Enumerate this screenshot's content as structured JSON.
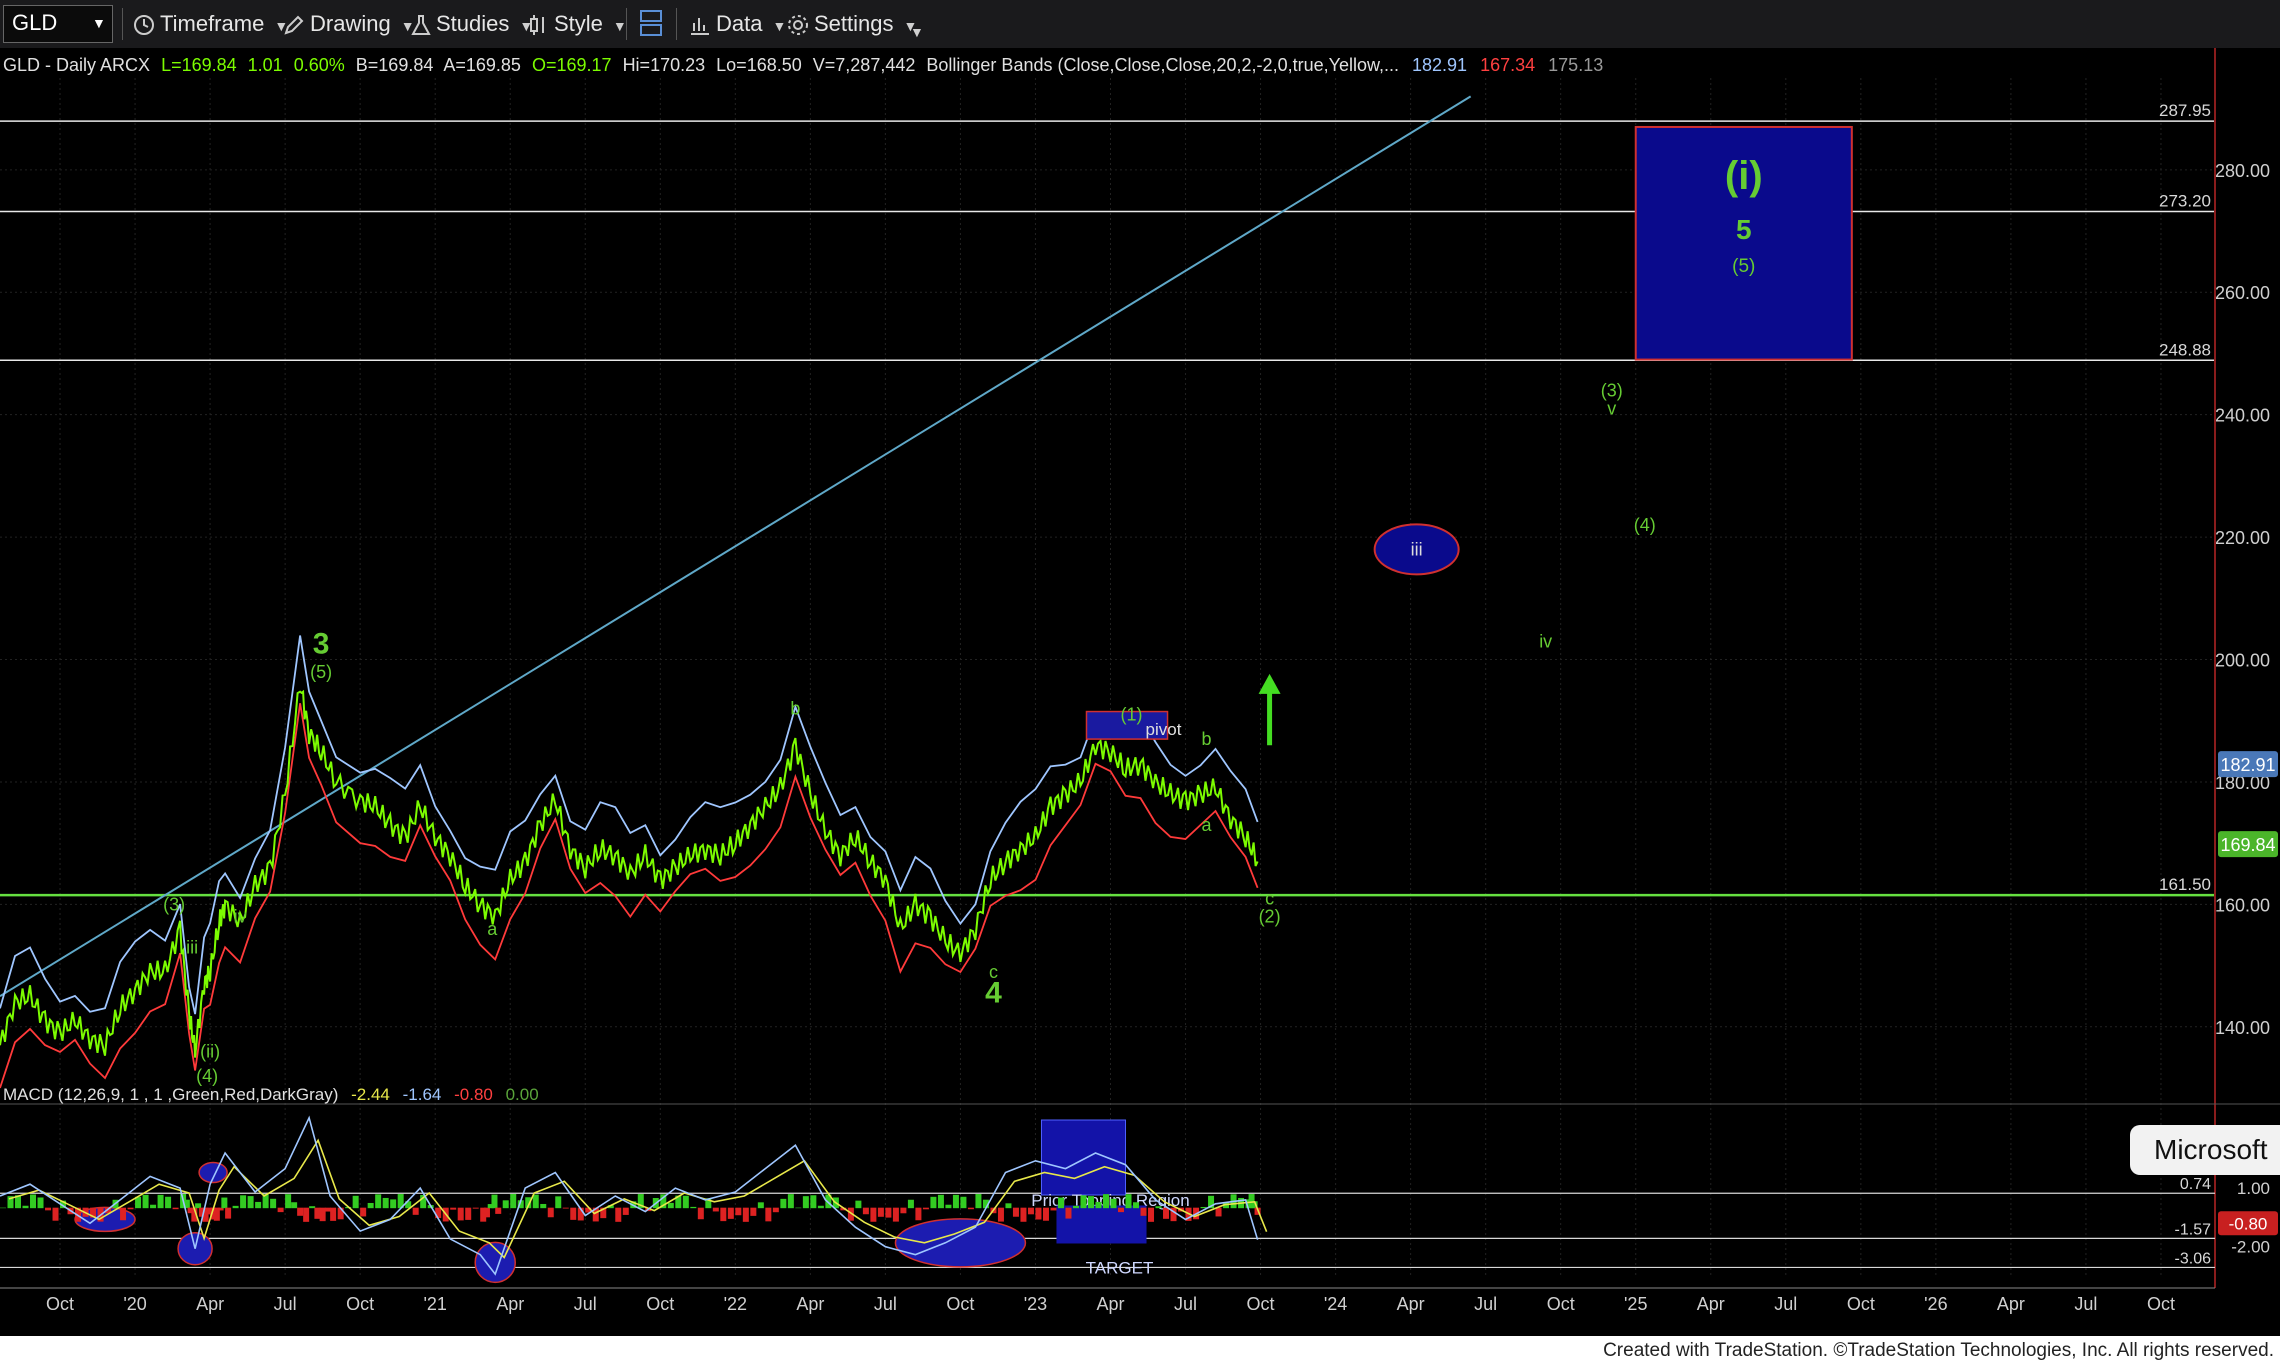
{
  "toolbar": {
    "symbol": "GLD",
    "timeframe": "Timeframe",
    "drawing": "Drawing",
    "studies": "Studies",
    "style": "Style",
    "data": "Data",
    "settings": "Settings"
  },
  "header": {
    "ticker": "GLD - Daily  ARCX",
    "last": "L=169.84",
    "change": "1.01",
    "change_pct": "0.60%",
    "bid": "B=169.84",
    "ask": "A=169.85",
    "open": "O=169.17",
    "high": "Hi=170.23",
    "low": "Lo=168.50",
    "volume": "V=7,287,442",
    "indicator": "Bollinger Bands (Close,Close,Close,20,2,-2,0,true,Yellow,...",
    "bb_upper": "182.91",
    "bb_lower": "167.34",
    "bb_mid": "175.13"
  },
  "macd_header": {
    "name": "MACD (12,26,9, 1 , 1 ,Green,Red,DarkGray)",
    "v1": "-2.44",
    "v2": "-1.64",
    "v3": "-0.80",
    "v4": "0.00"
  },
  "footer": "Created with TradeStation. ©TradeStation Technologies, Inc. All rights reserved.",
  "overlay_button": "Microsoft",
  "colors": {
    "background": "#000000",
    "price": "#7CFC00",
    "upper_band": "#9fc6ff",
    "lower_band": "#ff3a3a",
    "trendline": "#5fa8c8",
    "support": "#66e040",
    "level": "#e8e8e8",
    "label_green": "#66cc33",
    "box_blue": "#0a0a8c",
    "box_edge": "#d03030"
  },
  "chart_data": {
    "type": "line",
    "ylim": [
      130,
      295
    ],
    "y_ticks": [
      {
        "value": 140,
        "label": "140.00"
      },
      {
        "value": 160,
        "label": "160.00"
      },
      {
        "value": 180,
        "label": "180.00"
      },
      {
        "value": 200,
        "label": "200.00"
      },
      {
        "value": 220,
        "label": "220.00"
      },
      {
        "value": 240,
        "label": "240.00"
      },
      {
        "value": 260,
        "label": "260.00"
      },
      {
        "value": 280,
        "label": "280.00"
      }
    ],
    "x_ticks": [
      {
        "t": 2019.75,
        "label": "Oct"
      },
      {
        "t": 2020.0,
        "label": "'20"
      },
      {
        "t": 2020.25,
        "label": "Apr"
      },
      {
        "t": 2020.5,
        "label": "Jul"
      },
      {
        "t": 2020.75,
        "label": "Oct"
      },
      {
        "t": 2021.0,
        "label": "'21"
      },
      {
        "t": 2021.25,
        "label": "Apr"
      },
      {
        "t": 2021.5,
        "label": "Jul"
      },
      {
        "t": 2021.75,
        "label": "Oct"
      },
      {
        "t": 2022.0,
        "label": "'22"
      },
      {
        "t": 2022.25,
        "label": "Apr"
      },
      {
        "t": 2022.5,
        "label": "Jul"
      },
      {
        "t": 2022.75,
        "label": "Oct"
      },
      {
        "t": 2023.0,
        "label": "'23"
      },
      {
        "t": 2023.25,
        "label": "Apr"
      },
      {
        "t": 2023.5,
        "label": "Jul"
      },
      {
        "t": 2023.75,
        "label": "Oct"
      },
      {
        "t": 2024.0,
        "label": "'24"
      },
      {
        "t": 2024.25,
        "label": "Apr"
      },
      {
        "t": 2024.5,
        "label": "Jul"
      },
      {
        "t": 2024.75,
        "label": "Oct"
      },
      {
        "t": 2025.0,
        "label": "'25"
      },
      {
        "t": 2025.25,
        "label": "Apr"
      },
      {
        "t": 2025.5,
        "label": "Jul"
      },
      {
        "t": 2025.75,
        "label": "Oct"
      },
      {
        "t": 2026.0,
        "label": "'26"
      },
      {
        "t": 2026.25,
        "label": "Apr"
      },
      {
        "t": 2026.5,
        "label": "Jul"
      },
      {
        "t": 2026.75,
        "label": "Oct"
      }
    ],
    "price_series": {
      "t": [
        2019.55,
        2019.6,
        2019.65,
        2019.7,
        2019.75,
        2019.8,
        2019.85,
        2019.9,
        2019.95,
        2020.0,
        2020.05,
        2020.1,
        2020.15,
        2020.18,
        2020.2,
        2020.23,
        2020.25,
        2020.28,
        2020.3,
        2020.35,
        2020.4,
        2020.45,
        2020.5,
        2020.55,
        2020.58,
        2020.62,
        2020.67,
        2020.75,
        2020.8,
        2020.85,
        2020.9,
        2020.95,
        2021.0,
        2021.05,
        2021.1,
        2021.15,
        2021.2,
        2021.25,
        2021.3,
        2021.35,
        2021.4,
        2021.45,
        2021.5,
        2021.55,
        2021.6,
        2021.65,
        2021.7,
        2021.75,
        2021.8,
        2021.85,
        2021.9,
        2021.95,
        2022.0,
        2022.05,
        2022.1,
        2022.15,
        2022.2,
        2022.25,
        2022.3,
        2022.35,
        2022.4,
        2022.45,
        2022.5,
        2022.55,
        2022.6,
        2022.65,
        2022.7,
        2022.75,
        2022.8,
        2022.85,
        2022.9,
        2022.95,
        2023.0,
        2023.05,
        2023.1,
        2023.15,
        2023.2,
        2023.25,
        2023.3,
        2023.35,
        2023.4,
        2023.45,
        2023.5,
        2023.55,
        2023.6,
        2023.65,
        2023.7,
        2023.74
      ],
      "close": [
        137,
        144,
        145,
        141,
        139,
        141,
        138,
        137,
        143,
        146,
        149,
        149,
        156,
        142,
        136,
        147,
        149,
        157,
        160,
        157,
        163,
        166,
        178,
        196,
        188,
        185,
        180,
        177,
        176,
        173,
        171,
        176,
        171,
        168,
        163,
        160,
        158,
        164,
        167,
        173,
        177,
        169,
        166,
        169,
        168,
        165,
        168,
        164,
        166,
        168,
        169,
        168,
        170,
        173,
        176,
        179,
        186,
        178,
        172,
        168,
        171,
        167,
        164,
        156,
        160,
        158,
        154,
        152,
        156,
        164,
        167,
        169,
        171,
        176,
        178,
        180,
        186,
        185,
        182,
        183,
        180,
        178,
        177,
        178,
        179,
        174,
        171,
        167
      ]
    },
    "levels": [
      {
        "value": 287.95,
        "label": "287.95"
      },
      {
        "value": 273.2,
        "label": "273.20"
      },
      {
        "value": 248.88,
        "label": "248.88"
      },
      {
        "value": 161.5,
        "label": "161.50"
      }
    ],
    "price_markers": [
      {
        "value": 182.91,
        "label": "182.91"
      },
      {
        "value": 169.84,
        "label": "169.84"
      }
    ],
    "trendline": {
      "t0": 2019.55,
      "v0": 145,
      "t1": 2024.45,
      "v1": 292
    },
    "target_box": {
      "t0": 2025.0,
      "t1": 2025.72,
      "v0": 249,
      "v1": 287,
      "labels": [
        "(i)",
        "5",
        "(5)"
      ]
    },
    "pivot_box": {
      "t0": 2023.17,
      "t1": 2023.44,
      "v0": 187,
      "v1": 191.5,
      "label": "pivot"
    },
    "iii_ellipse": {
      "t": 2024.27,
      "v": 218,
      "label": "iii"
    },
    "wave_labels": [
      {
        "text": "3",
        "t": 2020.62,
        "v": 201,
        "big": true
      },
      {
        "text": "(5)",
        "t": 2020.62,
        "v": 197,
        "big": false
      },
      {
        "text": "iii",
        "t": 2020.19,
        "v": 152,
        "big": false
      },
      {
        "text": "(3)",
        "t": 2020.13,
        "v": 159,
        "big": false
      },
      {
        "text": "iv",
        "t": 2020.35,
        "v": 157,
        "big": false
      },
      {
        "text": "(ii)",
        "t": 2020.25,
        "v": 135,
        "big": false
      },
      {
        "text": "(4)",
        "t": 2020.24,
        "v": 131,
        "big": false
      },
      {
        "text": "a",
        "t": 2021.19,
        "v": 155,
        "big": false
      },
      {
        "text": "b",
        "t": 2022.2,
        "v": 191,
        "big": false
      },
      {
        "text": "c",
        "t": 2022.86,
        "v": 148,
        "big": false
      },
      {
        "text": "4",
        "t": 2022.86,
        "v": 144,
        "big": true
      },
      {
        "text": "(1)",
        "t": 2023.32,
        "v": 190,
        "big": false
      },
      {
        "text": "b",
        "t": 2023.57,
        "v": 186,
        "big": false
      },
      {
        "text": "a",
        "t": 2023.57,
        "v": 172,
        "big": false
      },
      {
        "text": "c",
        "t": 2023.78,
        "v": 160,
        "big": false
      },
      {
        "text": "(2)",
        "t": 2023.78,
        "v": 157,
        "big": false
      },
      {
        "text": "iv",
        "t": 2024.7,
        "v": 202,
        "big": false
      },
      {
        "text": "(3)",
        "t": 2024.92,
        "v": 243,
        "big": false
      },
      {
        "text": "v",
        "t": 2024.92,
        "v": 240,
        "big": false
      },
      {
        "text": "(4)",
        "t": 2025.03,
        "v": 221,
        "big": false
      }
    ],
    "arrow": {
      "t": 2023.78,
      "v0": 186,
      "v1": 197
    },
    "macd": {
      "y_ticks": [
        {
          "value": 1.0,
          "label": "1.00"
        },
        {
          "value": -2.0,
          "label": "-2.00"
        }
      ],
      "levels": [
        {
          "value": 0.74,
          "label": "0.74"
        },
        {
          "value": -1.57,
          "label": "-1.57"
        },
        {
          "value": -3.06,
          "label": "-3.06"
        }
      ],
      "current": {
        "value": -0.8,
        "label": "-0.80"
      },
      "annotations": [
        "Prior Topping Region",
        "TARGET"
      ],
      "t": [
        2019.55,
        2019.65,
        2019.75,
        2019.85,
        2019.95,
        2020.05,
        2020.15,
        2020.2,
        2020.25,
        2020.3,
        2020.4,
        2020.5,
        2020.58,
        2020.65,
        2020.75,
        2020.85,
        2020.95,
        2021.05,
        2021.15,
        2021.2,
        2021.3,
        2021.4,
        2021.5,
        2021.6,
        2021.7,
        2021.8,
        2021.9,
        2022.0,
        2022.1,
        2022.2,
        2022.3,
        2022.4,
        2022.5,
        2022.6,
        2022.7,
        2022.8,
        2022.9,
        2023.0,
        2023.1,
        2023.2,
        2023.3,
        2023.4,
        2023.5,
        2023.6,
        2023.7,
        2023.74
      ],
      "line": [
        0.6,
        1.2,
        0.2,
        -0.8,
        0.4,
        1.6,
        1.0,
        -2.1,
        1.2,
        2.8,
        0.8,
        2.0,
        4.6,
        0.6,
        -1.2,
        -0.6,
        1.0,
        -1.6,
        -2.4,
        -3.4,
        1.0,
        1.8,
        -0.4,
        0.6,
        -0.2,
        1.0,
        0.4,
        0.8,
        2.0,
        3.2,
        0.4,
        -1.0,
        -2.0,
        -2.4,
        -1.8,
        -1.0,
        1.8,
        2.4,
        2.0,
        2.8,
        2.2,
        0.4,
        -0.6,
        0.2,
        0.4,
        -1.64
      ]
    }
  }
}
